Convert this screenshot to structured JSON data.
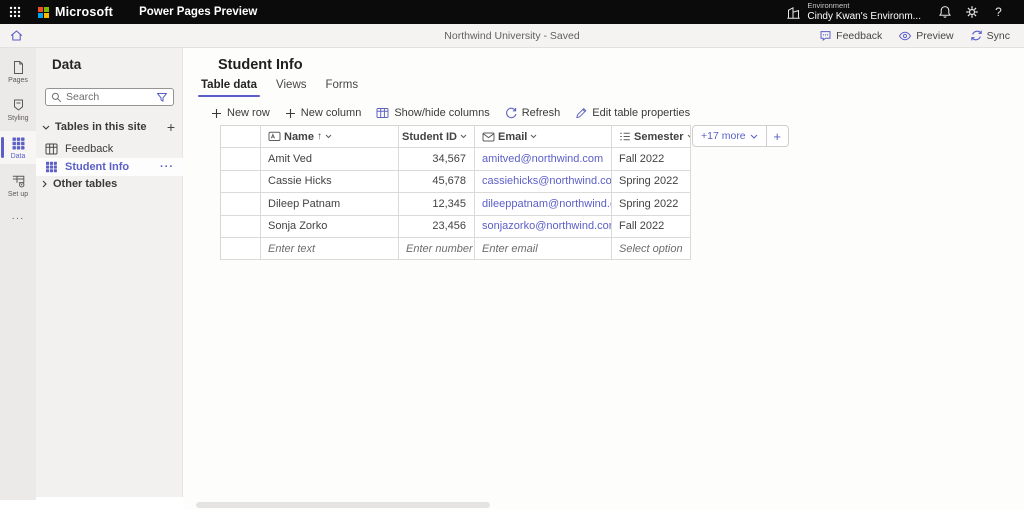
{
  "topbar": {
    "brand": "Microsoft",
    "app_title": "Power Pages Preview",
    "environment_label": "Environment",
    "environment_name": "Cindy Kwan's Environm...",
    "help_label": "?"
  },
  "commandbar": {
    "site_status": "Northwind University - Saved",
    "actions": [
      {
        "label": "Feedback"
      },
      {
        "label": "Preview"
      },
      {
        "label": "Sync"
      }
    ]
  },
  "rail": {
    "items": [
      {
        "label": "Pages"
      },
      {
        "label": "Styling"
      },
      {
        "label": "Data",
        "selected": true
      },
      {
        "label": "Set up"
      }
    ],
    "more_label": "···"
  },
  "panel": {
    "title": "Data",
    "search_placeholder": "Search",
    "section_title": "Tables in this site",
    "add_label": "+",
    "tables": [
      {
        "name": "Feedback"
      },
      {
        "name": "Student Info",
        "selected": true,
        "more": "···"
      }
    ],
    "other_tables_label": "Other tables"
  },
  "main": {
    "title": "Student Info",
    "tabs": [
      {
        "label": "Table data",
        "selected": true
      },
      {
        "label": "Views"
      },
      {
        "label": "Forms"
      }
    ],
    "toolbar": [
      {
        "label": "New row"
      },
      {
        "label": "New column"
      },
      {
        "label": "Show/hide columns"
      },
      {
        "label": "Refresh"
      },
      {
        "label": "Edit table properties"
      }
    ],
    "more_columns_label": "+17 more",
    "add_column_label": "+",
    "table": {
      "columns": [
        {
          "label": "Name",
          "type": "text",
          "sorted_ascending": true
        },
        {
          "label": "Student ID",
          "type": "number"
        },
        {
          "label": "Email",
          "type": "email"
        },
        {
          "label": "Semester",
          "type": "choice"
        }
      ],
      "rows": [
        {
          "name": "Amit Ved",
          "student_id": "34,567",
          "email": "amitved@northwind.com",
          "semester": "Fall 2022"
        },
        {
          "name": "Cassie Hicks",
          "student_id": "45,678",
          "email": "cassiehicks@northwind.com",
          "semester": "Spring 2022"
        },
        {
          "name": "Dileep Patnam",
          "student_id": "12,345",
          "email": "dileeppatnam@northwind.com",
          "semester": "Spring 2022"
        },
        {
          "name": "Sonja Zorko",
          "student_id": "23,456",
          "email": "sonjazorko@northwind.com",
          "semester": "Fall 2022"
        }
      ],
      "new_row_placeholders": {
        "name": "Enter text",
        "student_id": "Enter number",
        "email": "Enter email",
        "semester": "Select option"
      }
    }
  },
  "colors": {
    "accent": "#5b5fc7",
    "topbar_bg": "#0b0b0b",
    "link": "#5b5fc7",
    "ms_logo_red": "#f25022",
    "ms_logo_green": "#7fba00",
    "ms_logo_blue": "#00a4ef",
    "ms_logo_yellow": "#ffb900"
  }
}
